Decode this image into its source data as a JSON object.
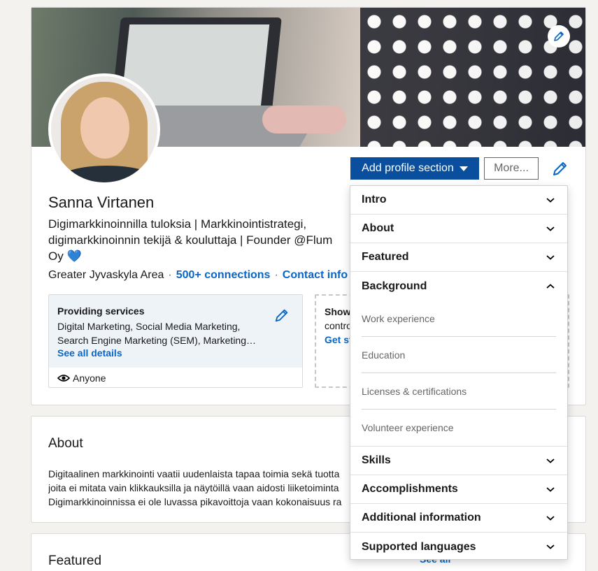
{
  "profile": {
    "name": "Sanna Virtanen",
    "headline": "Digimarkkinoinnilla tuloksia | Markkinointistrategi, digimarkkinoinnin tekijä & kouluttaja | Founder @Flum\nOy 💙",
    "location": "Greater Jyvaskyla Area",
    "connections": "500+ connections",
    "contact": "Contact info"
  },
  "actions": {
    "add_section": "Add profile section",
    "more": "More..."
  },
  "services": {
    "title": "Providing services",
    "description": "Digital Marketing, Social Media Marketing, Search Engine Marketing (SEM), Marketing…",
    "see_all": "See all details",
    "visibility": "Anyone"
  },
  "showcase": {
    "title": "Show",
    "desc": "contro",
    "link": "Get st"
  },
  "about": {
    "title": "About",
    "lines": [
      "Digitaalinen markkinointi vaatii uudenlaista tapaa toimia sekä tuotta",
      "joita ei mitata vain klikkauksilla ja näytöillä vaan aidosti liiketoiminta",
      "Digimarkkinoinnissa ei ole luvassa pikavoittoja vaan kokonaisuus ra"
    ]
  },
  "featured": {
    "title": "Featured",
    "see_all": "See all"
  },
  "dropdown": {
    "sections": [
      {
        "label": "Intro",
        "state": "collapsed"
      },
      {
        "label": "About",
        "state": "collapsed"
      },
      {
        "label": "Featured",
        "state": "collapsed"
      },
      {
        "label": "Background",
        "state": "expanded"
      }
    ],
    "background_items": [
      "Work experience",
      "Education",
      "Licenses & certifications",
      "Volunteer experience"
    ],
    "sections_after": [
      {
        "label": "Skills",
        "state": "collapsed"
      },
      {
        "label": "Accomplishments",
        "state": "collapsed"
      },
      {
        "label": "Additional information",
        "state": "collapsed"
      },
      {
        "label": "Supported languages",
        "state": "collapsed"
      }
    ]
  },
  "colors": {
    "accent": "#0a66c2",
    "button_primary": "#0a4f9e",
    "page_bg": "#f3f2ef"
  }
}
